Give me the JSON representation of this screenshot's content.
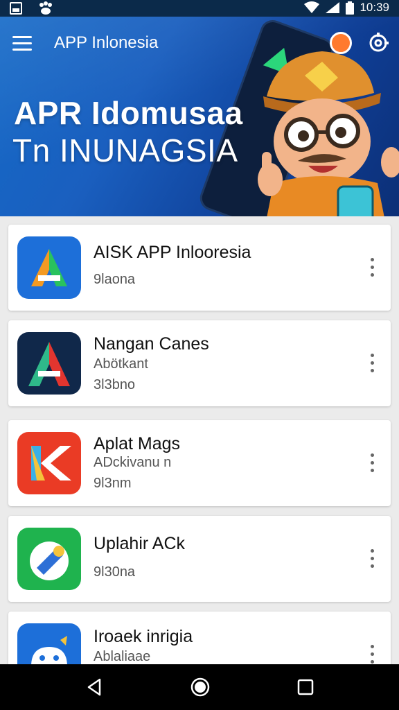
{
  "status_bar": {
    "time": "10:39",
    "left_icons": [
      "image-icon",
      "paw-icon"
    ],
    "right_icons": [
      "wifi-icon",
      "signal-icon",
      "battery-icon"
    ]
  },
  "app_bar": {
    "title": "APP Inlonesia",
    "menu_icon": "hamburger-menu-icon",
    "action_icons": [
      "orange-badge-icon",
      "gear-icon"
    ]
  },
  "hero": {
    "title_line_1": "APR Idomusaa",
    "title_line_2": "Tn INUNAGSIA"
  },
  "apps": [
    {
      "name": "AISK APP Inlooresia",
      "subtitle": "",
      "meta": "9laona",
      "icon": "green-orange-a-icon"
    },
    {
      "name": "Nangan Canes",
      "subtitle": "Abötkant",
      "meta": "3l3bno",
      "icon": "red-green-a-icon"
    },
    {
      "name": "Aplat Mags",
      "subtitle": "ADckivanu n",
      "meta": "9l3nm",
      "icon": "k-letter-icon"
    },
    {
      "name": "Uplahir ACk",
      "subtitle": "",
      "meta": "9l30na",
      "icon": "green-pill-icon"
    },
    {
      "name": "Iroaek inrigia",
      "subtitle": "Ablaliaae",
      "meta": "",
      "icon": "android-robot-icon"
    }
  ],
  "nav_bar": {
    "icons": [
      "back-icon",
      "home-icon",
      "recents-icon"
    ]
  },
  "colors": {
    "hero_blue": "#1a5fbf",
    "status_bar": "#0b2a4a",
    "card_bg": "#ffffff",
    "list_bg": "#ebebeb"
  }
}
